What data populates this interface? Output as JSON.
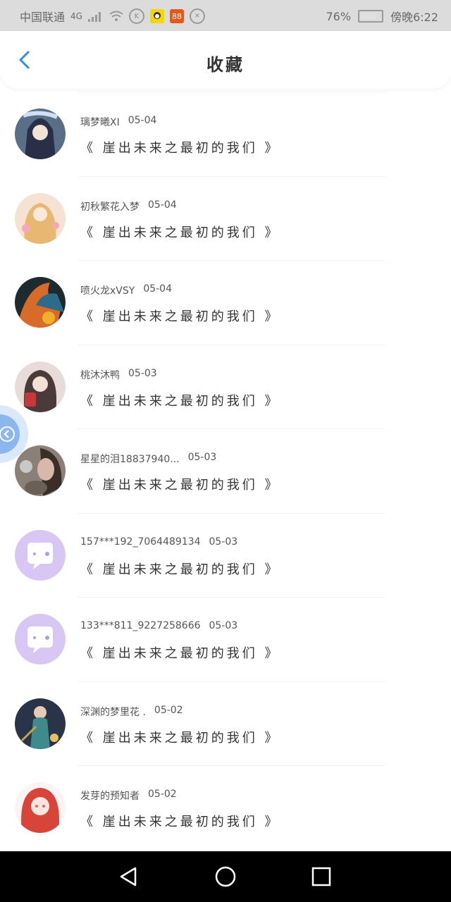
{
  "status_bar": {
    "carrier": "中国联通",
    "network": "4G",
    "battery": "76%",
    "time": "傍晚6:22",
    "icons": [
      "signal-icon",
      "wifi-icon",
      "k-icon",
      "qq-app-icon",
      "app-88-icon",
      "sync-icon",
      "battery-icon"
    ]
  },
  "header": {
    "back_icon": "back-arrow-icon",
    "title": "收藏"
  },
  "items": [
    {
      "name": "璃梦曦XI",
      "date": "05-04",
      "quote": "《 崖出未来之最初的我们 》",
      "avatar": "avatar-girl-blue"
    },
    {
      "name": "初秋繁花入梦",
      "date": "05-04",
      "quote": "《 崖出未来之最初的我们 》",
      "avatar": "avatar-girl-pink"
    },
    {
      "name": "喷火龙xVSY",
      "date": "05-04",
      "quote": "《 崖出未来之最初的我们 》",
      "avatar": "avatar-dragon"
    },
    {
      "name": "桃沐沐鸭",
      "date": "05-03",
      "quote": "《 崖出未来之最初的我们 》",
      "avatar": "avatar-girl-red"
    },
    {
      "name": "星星的泪18837940...",
      "date": "05-03",
      "quote": "《 崖出未来之最初的我们 》",
      "avatar": "avatar-photo"
    },
    {
      "name": "157***192_7064489134",
      "date": "05-03",
      "quote": "《 崖出未来之最初的我们 》",
      "avatar": "avatar-default-chat"
    },
    {
      "name": "133***811_9227258666",
      "date": "05-03",
      "quote": "《 崖出未来之最初的我们 》",
      "avatar": "avatar-default-chat"
    },
    {
      "name": "深渊的梦里花 .",
      "date": "05-02",
      "quote": "《 崖出未来之最初的我们 》",
      "avatar": "avatar-warrior"
    },
    {
      "name": "发芽的预知者",
      "date": "05-02",
      "quote": "《 崖出未来之最初的我们 》",
      "avatar": "avatar-girl-redhair"
    }
  ],
  "floating_button": {
    "icon": "close-circle-icon"
  },
  "nav_bar": {
    "icons": [
      "back-triangle-icon",
      "home-circle-icon",
      "recents-square-icon"
    ]
  },
  "colors": {
    "accent": "#2f8ee8",
    "status_bar_bg": "#dcdcdc",
    "nav_bar_bg": "#000000",
    "default_avatar": "#d8c6f5"
  }
}
